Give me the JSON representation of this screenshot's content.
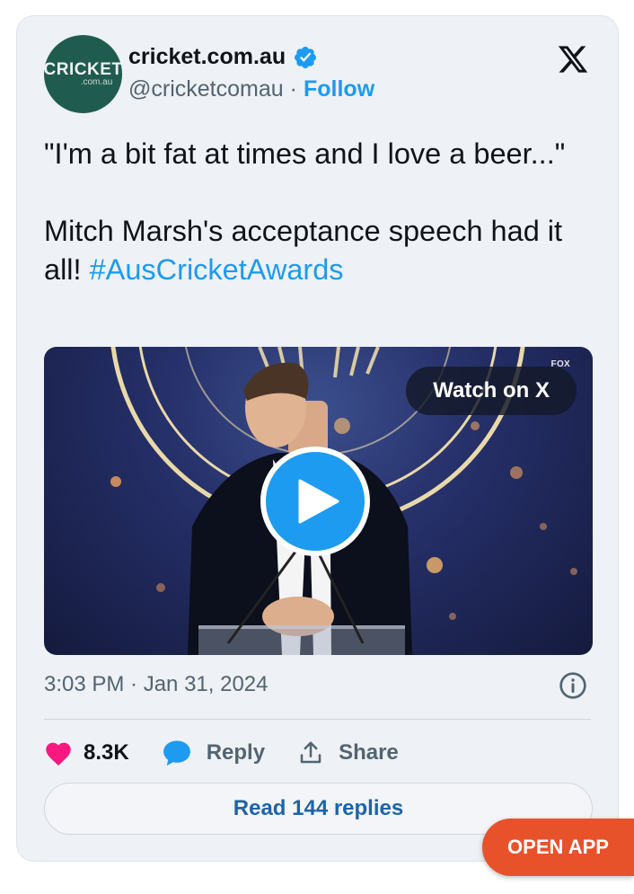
{
  "author": {
    "avatar_text": "CRICKET",
    "avatar_subtext": ".com.au",
    "display_name": "cricket.com.au",
    "handle": "@cricketcomau",
    "separator": "·",
    "follow_label": "Follow",
    "verified": true
  },
  "tweet": {
    "text": "\"I'm a bit fat at times and I love a beer...\"\n\nMitch Marsh's acceptance speech had it all! ",
    "hashtag": "#AusCricketAwards"
  },
  "media": {
    "watch_label": "Watch on X",
    "broadcaster": "FOX"
  },
  "timestamp": "3:03 PM · Jan 31, 2024",
  "actions": {
    "likes": "8.3K",
    "reply_label": "Reply",
    "share_label": "Share"
  },
  "read_replies_label": "Read 144 replies",
  "open_app_label": "OPEN APP",
  "colors": {
    "accent": "#1d9bf0",
    "like": "#f91880",
    "open_app": "#e8522b",
    "avatar_bg": "#1f5c4f"
  }
}
